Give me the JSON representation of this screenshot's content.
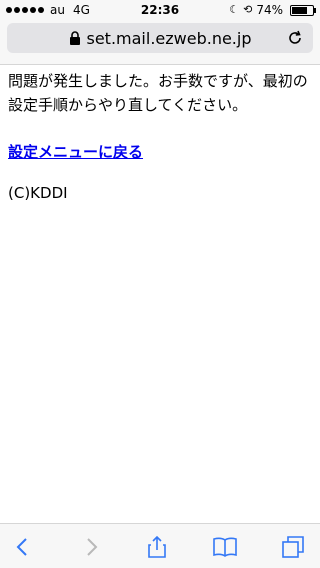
{
  "status_bar": {
    "carrier": "au",
    "network": "4G",
    "time": "22:36",
    "battery_percent": "74%",
    "battery_level": 0.74
  },
  "address_bar": {
    "url": "set.mail.ezweb.ne.jp"
  },
  "content": {
    "message": "問題が発生しました。お手数ですが、最初の設定手順からやり直してください。",
    "back_link_label": "設定メニューに戻る",
    "copyright": "(C)KDDI"
  },
  "colors": {
    "link": "#0000ee",
    "toolbar_icon": "#3478f6"
  },
  "icons": {
    "status": [
      "signal-dots-icon",
      "moon-icon",
      "rotation-lock-icon",
      "battery-icon"
    ],
    "toolbar": [
      "back-chevron-icon",
      "forward-chevron-icon",
      "share-icon",
      "bookmarks-icon",
      "tabs-icon"
    ]
  }
}
